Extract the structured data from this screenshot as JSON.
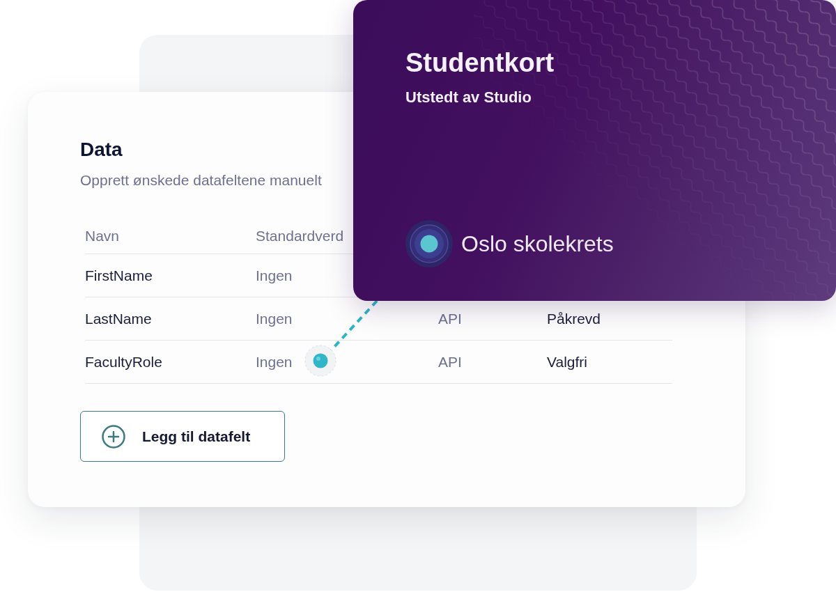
{
  "data_panel": {
    "title": "Data",
    "description": "Opprett ønskede datafeltene manuelt",
    "table": {
      "columns": [
        "Navn",
        "Standardverd"
      ],
      "rows": [
        {
          "cells": [
            "FirstName",
            "Ingen"
          ]
        },
        {
          "cells": [
            "LastName",
            "Ingen",
            "API",
            "Påkrevd"
          ]
        },
        {
          "cells": [
            "FacultyRole",
            "Ingen",
            "API",
            "Valgfri"
          ]
        }
      ]
    },
    "add_button": {
      "label": "Legg til datafelt"
    }
  },
  "student_card": {
    "title": "Studentkort",
    "issuer": "Utstedt av Studio",
    "organization": "Oslo skolekrets"
  }
}
